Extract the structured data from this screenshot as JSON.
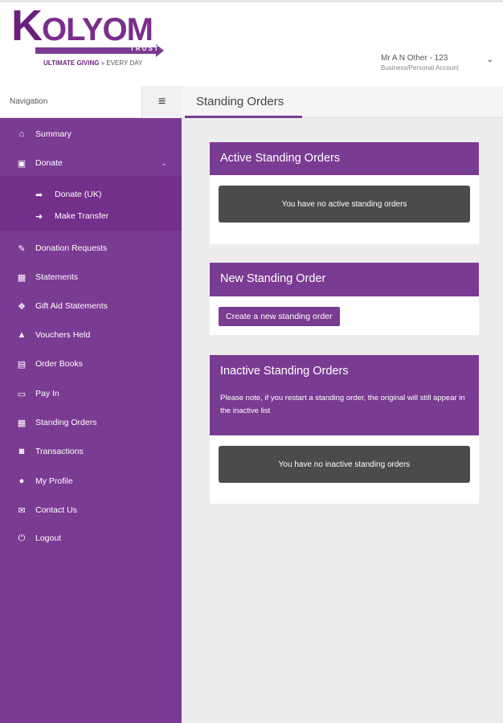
{
  "brand": {
    "name_first": "K",
    "name_rest": "OLYOM",
    "sub": "TRUST",
    "tagline_bold": "ULTIMATE GIVING",
    "tagline_rest": " » EVERY DAY"
  },
  "user": {
    "name": "Mr A N Other - 123",
    "account_type": "Business/Personal Account",
    "chevron": "⌄"
  },
  "nav_header": {
    "label": "Navigation",
    "toggle_glyph": "≡"
  },
  "page": {
    "title": "Standing Orders"
  },
  "sidebar": {
    "items": [
      {
        "label": "Summary",
        "icon": "home-icon",
        "glyph": "⌂"
      },
      {
        "label": "Donate",
        "icon": "money-icon",
        "glyph": "▣"
      },
      {
        "label": "Donation Requests",
        "icon": "edit-icon",
        "glyph": "✎"
      },
      {
        "label": "Statements",
        "icon": "calendar-icon",
        "glyph": "▦"
      },
      {
        "label": "Gift Aid Statements",
        "icon": "gift-icon",
        "glyph": "❖"
      },
      {
        "label": "Vouchers Held",
        "icon": "warning-icon",
        "glyph": "▲"
      },
      {
        "label": "Order Books",
        "icon": "book-icon",
        "glyph": "▤"
      },
      {
        "label": "Pay In",
        "icon": "credit-card-icon",
        "glyph": "▭"
      },
      {
        "label": "Standing Orders",
        "icon": "calendar-icon",
        "glyph": "▦"
      },
      {
        "label": "Transactions",
        "icon": "binoculars-icon",
        "glyph": "◙"
      },
      {
        "label": "My Profile",
        "icon": "user-icon",
        "glyph": "●"
      },
      {
        "label": "Contact Us",
        "icon": "envelope-icon",
        "glyph": "✉"
      },
      {
        "label": "Logout",
        "icon": "power-icon",
        "glyph": "⏻"
      }
    ],
    "donate_chevron": "⌄",
    "sub_items": [
      {
        "label": "Donate (UK)",
        "icon": "share-icon",
        "glyph": "➦"
      },
      {
        "label": "Make Transfer",
        "icon": "sign-in-icon",
        "glyph": "➜"
      }
    ]
  },
  "panels": {
    "active": {
      "title": "Active Standing Orders",
      "empty_message": "You have no active standing orders"
    },
    "new": {
      "title": "New Standing Order",
      "button_label": "Create a new standing order"
    },
    "inactive": {
      "title": "Inactive Standing Orders",
      "note": "Please note, if you restart a standing order, the original will still appear in the inactive list",
      "empty_message": "You have no inactive standing orders"
    }
  },
  "colors": {
    "brand_purple": "#7a3b92",
    "dark_box": "#4b4b4b",
    "background": "#ededee"
  }
}
